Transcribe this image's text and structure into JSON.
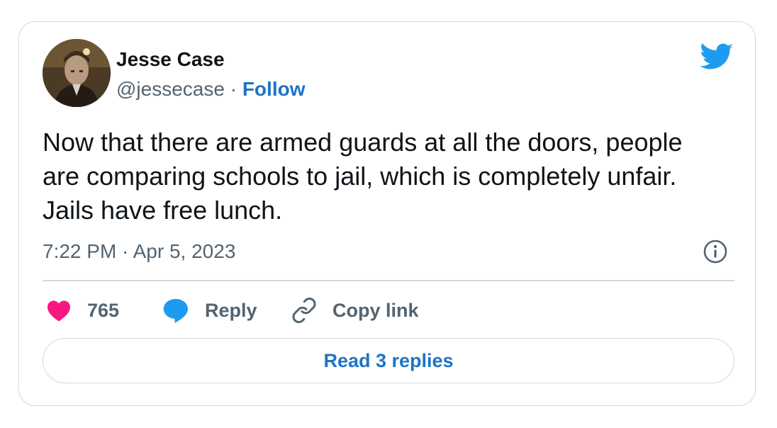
{
  "author": {
    "name": "Jesse Case",
    "handle": "@jessecase",
    "separator": " · ",
    "follow_label": "Follow"
  },
  "tweet": {
    "text": "Now that there are armed guards at all the doors, people are comparing schools to jail, which is completely unfair. Jails have free lunch.",
    "timestamp": "7:22 PM · Apr 5, 2023"
  },
  "actions": {
    "likes_count": "765",
    "reply_label": "Reply",
    "copy_link_label": "Copy link"
  },
  "read_replies_label": "Read 3 replies",
  "colors": {
    "brand_blue": "#1d9bf0",
    "link_blue": "#1d74c8",
    "like_pink": "#f91880",
    "text_primary": "#0f1419",
    "text_secondary": "#536471",
    "border": "#cfd9de"
  },
  "icons": {
    "brand": "twitter-bird-icon",
    "like": "heart-icon",
    "reply": "speech-bubble-icon",
    "copy": "link-icon",
    "info": "info-icon"
  }
}
